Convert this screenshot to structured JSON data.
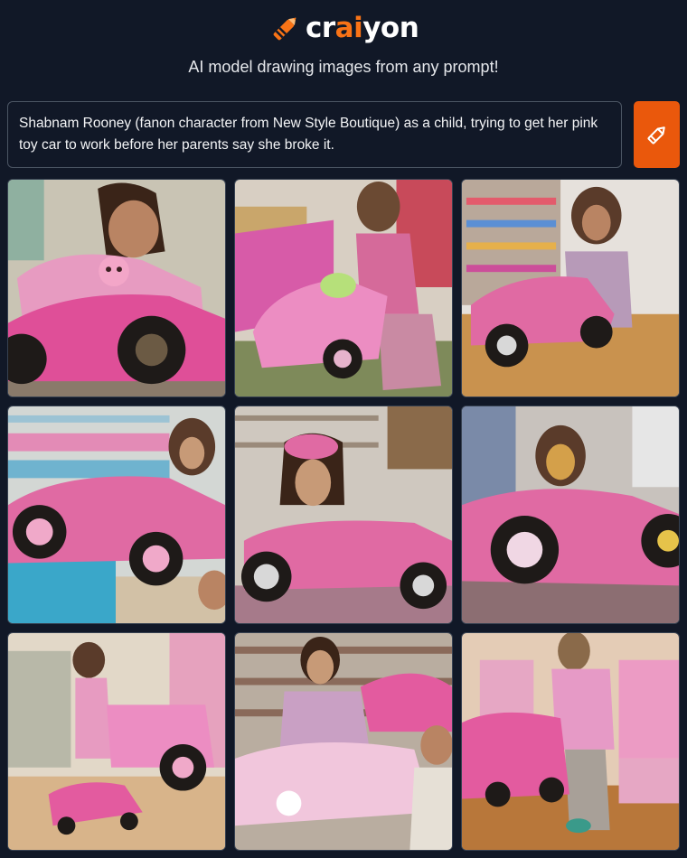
{
  "brand": {
    "name_part1": "cr",
    "name_accent": "ai",
    "name_part2": "yon",
    "accent_color": "#f97316"
  },
  "tagline": "AI model drawing images from any prompt!",
  "prompt": {
    "text": "Shabnam Rooney (fanon character from New Style Boutique) as a child, trying to get her pink toy car to work before her parents say she broke it."
  },
  "draw_button": {
    "icon": "pencil-icon",
    "color": "#ea580c"
  },
  "colors": {
    "background": "#111827",
    "toy_pink": "#e0559c"
  },
  "results": {
    "count": 9,
    "images": [
      {
        "depicts": "girl in pink sweater pushing a pink toy car"
      },
      {
        "depicts": "child beside a pink convertible toy car in a toy store"
      },
      {
        "depicts": "girl standing behind a pink toy car on a wooden floor"
      },
      {
        "depicts": "pink toy car with child in front of toy shelves"
      },
      {
        "depicts": "girl with pink bow over a pink toy car"
      },
      {
        "depicts": "close-up of pink toy car with a child behind it"
      },
      {
        "depicts": "child in pink near a pink toy car in a store aisle"
      },
      {
        "depicts": "girl and boy with a pink toy car in a toy store"
      },
      {
        "depicts": "girl in pink sweater with a small pink toy car"
      }
    ]
  }
}
